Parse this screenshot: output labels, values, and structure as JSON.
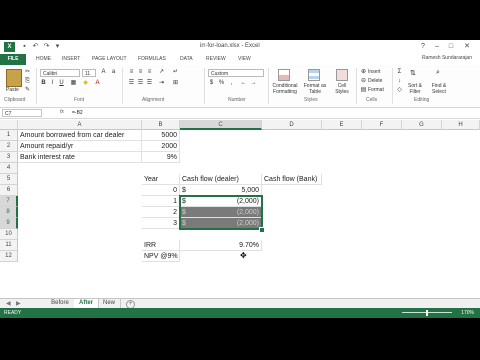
{
  "window": {
    "title": "irr-for-loan.xlsx - Excel",
    "user": "Ramesh Sundararajan"
  },
  "ribbon_tabs": [
    "FILE",
    "HOME",
    "INSERT",
    "PAGE LAYOUT",
    "FORMULAS",
    "DATA",
    "REVIEW",
    "VIEW"
  ],
  "ribbon": {
    "paste": "Paste",
    "font_name": "Calibri",
    "font_size": "11",
    "number_format": "Custom",
    "conditional_formatting": "Conditional Formatting",
    "format_as_table": "Format as Table",
    "cell_styles": "Cell Styles",
    "insert": "Insert",
    "delete": "Delete",
    "format": "Format",
    "sort_filter": "Sort & Filter",
    "find_select": "Find & Select",
    "groups": [
      "Clipboard",
      "Font",
      "Alignment",
      "Number",
      "Styles",
      "Cells",
      "Editing"
    ]
  },
  "formula_bar": {
    "name_box": "C7",
    "fx": "fx",
    "formula": "=-B2"
  },
  "columns": [
    "A",
    "B",
    "C",
    "D",
    "E",
    "F",
    "G",
    "H"
  ],
  "rows": [
    "1",
    "2",
    "3",
    "4",
    "5",
    "6",
    "7",
    "8",
    "9",
    "10",
    "11",
    "12"
  ],
  "cells": {
    "A1": "Amount borrowed from car dealer",
    "B1": "5000",
    "A2": "Amount repaid/yr",
    "B2": "2000",
    "A3": "Bank interest rate",
    "B3": "9%",
    "B5": "Year",
    "C5": "Cash flow (dealer)",
    "D5": "Cash flow (Bank)",
    "B6": "0",
    "C6_sym": "$",
    "C6_val": "5,000",
    "B7": "1",
    "C7_sym": "$",
    "C7_val": "(2,000)",
    "B8": "2",
    "C8_sym": "$",
    "C8_val": "(2,000)",
    "B9": "3",
    "C9_sym": "$",
    "C9_val": "(2,000)",
    "B11": "IRR",
    "C11": "9.70%",
    "B12": "NPV @9%"
  },
  "sheets": [
    "Before",
    "After",
    "New"
  ],
  "active_sheet": "After",
  "status": {
    "mode": "READY",
    "zoom": "170%"
  },
  "colors": {
    "excel_green": "#217346",
    "selection_fill": "#7a7a7a"
  },
  "icons": [
    "excel-logo-icon",
    "save-icon",
    "undo-icon",
    "redo-icon",
    "paste-icon",
    "add-sheet-icon",
    "cursor-icon"
  ]
}
